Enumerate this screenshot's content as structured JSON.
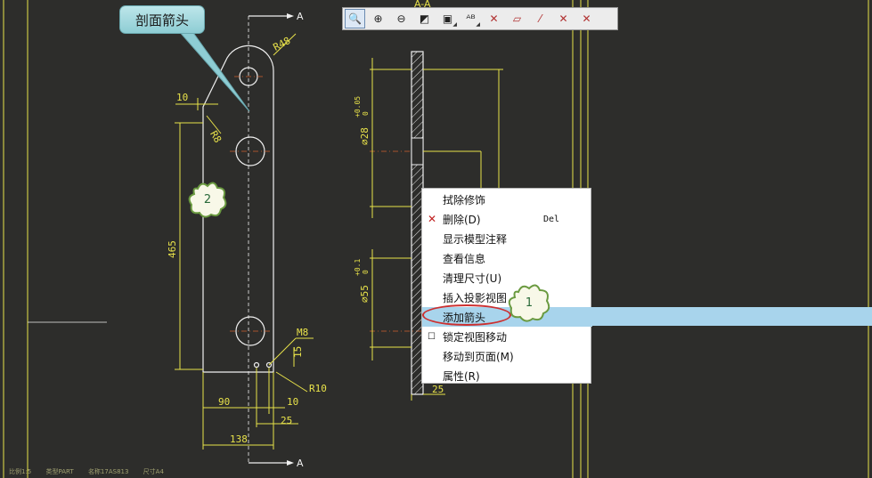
{
  "callout": {
    "label": "剖面箭头"
  },
  "section_marks": {
    "top": "A",
    "bottom": "A",
    "view_title": "A-A"
  },
  "drawing": {
    "dims": {
      "r48": "R48",
      "d10": "10",
      "r8": "R8",
      "d465": "465",
      "m8": "M8",
      "d15": "15",
      "r10": "R10",
      "d90": "90",
      "d10b": "10",
      "d25": "25",
      "d138": "138",
      "dia28": "⌀28",
      "dia28_tol_up": "+0.05",
      "dia28_tol_low": "0",
      "dia55": "⌀55",
      "dia55_tol_up": "+0.1",
      "dia55_tol_low": "0",
      "d25r": "25"
    }
  },
  "toolbar": {
    "buttons": [
      {
        "icon": "zoom-fit-icon",
        "glyph": "🔍"
      },
      {
        "icon": "zoom-in-icon",
        "glyph": "⊕"
      },
      {
        "icon": "zoom-out-icon",
        "glyph": "⊖"
      },
      {
        "icon": "repaint-icon",
        "glyph": "◩"
      },
      {
        "icon": "display-style-icon",
        "glyph": "▣"
      },
      {
        "icon": "annotation-display-icon",
        "glyph": "ᴬᴮ"
      },
      {
        "icon": "datum-plane-icon",
        "glyph": "✕"
      },
      {
        "icon": "datum-axis-icon",
        "glyph": "▱"
      },
      {
        "icon": "point-display-icon",
        "glyph": "⁄"
      },
      {
        "icon": "csys-display-icon",
        "glyph": "✕"
      },
      {
        "icon": "spin-center-icon",
        "glyph": "✕"
      }
    ]
  },
  "context_menu": {
    "items": [
      {
        "label": "拭除修饰",
        "shortcut": "",
        "mark": ""
      },
      {
        "label": "删除(D)",
        "shortcut": "Del",
        "mark": "✕"
      },
      {
        "label": "显示模型注释",
        "shortcut": "",
        "mark": ""
      },
      {
        "label": "查看信息",
        "shortcut": "",
        "mark": ""
      },
      {
        "label": "清理尺寸(U)",
        "shortcut": "",
        "mark": ""
      },
      {
        "label": "插入投影视图",
        "shortcut": "",
        "mark": ""
      },
      {
        "label": "添加箭头",
        "shortcut": "",
        "mark": ""
      },
      {
        "label": "锁定视图移动",
        "shortcut": "",
        "mark": "☐"
      },
      {
        "label": "移动到页面(M)",
        "shortcut": "",
        "mark": ""
      },
      {
        "label": "属性(R)",
        "shortcut": "",
        "mark": ""
      }
    ],
    "highlighted_index": 6
  },
  "step_badges": {
    "step1": "1",
    "step2": "2"
  },
  "status_bar": {
    "scale": "比例1:5",
    "type": "类型PART",
    "name": "名称17AS813",
    "size": "尺寸A4"
  },
  "colors": {
    "background": "#2d2d2b",
    "line": "#e8e24a",
    "highlight": "#a8d4ec",
    "oval": "#cc3030"
  }
}
